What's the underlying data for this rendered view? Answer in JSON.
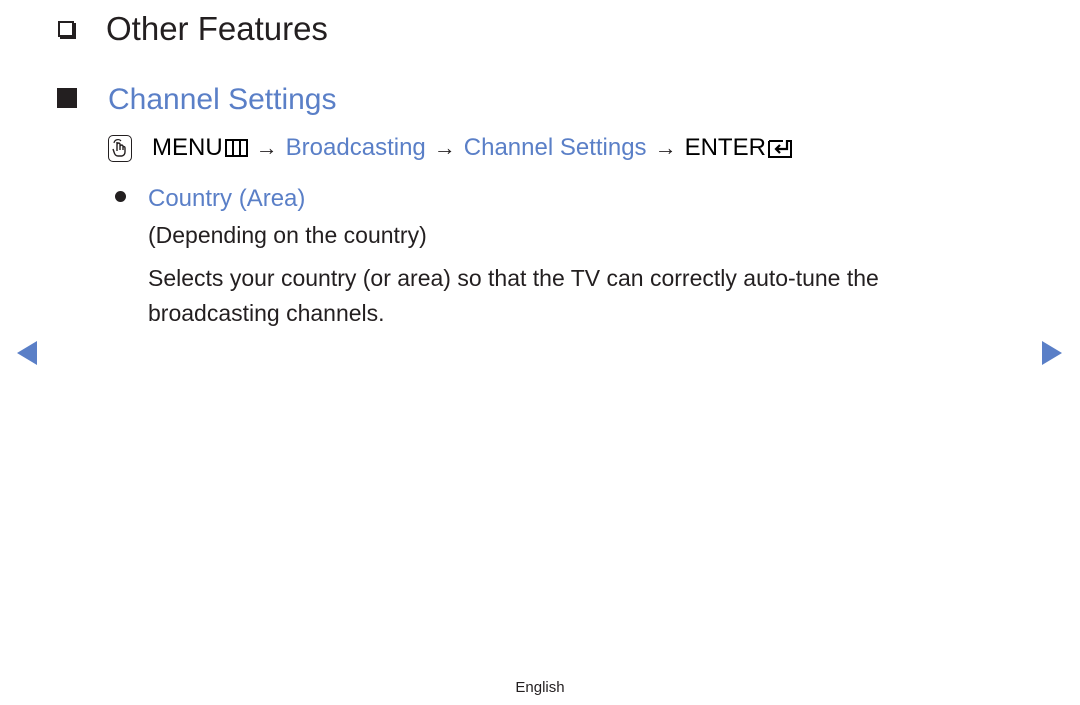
{
  "heading": {
    "icon": "checkbox-outline-icon",
    "title": "Other Features"
  },
  "section": {
    "icon": "filled-square-icon",
    "title": "Channel Settings"
  },
  "menu_path": {
    "remote_icon": "remote-touch-icon",
    "menu_label": "MENU",
    "menu_icon": "menu-grid-icon",
    "arrow": "→",
    "steps": [
      "Broadcasting",
      "Channel Settings"
    ],
    "enter_label": "ENTER",
    "enter_icon": "enter-return-icon"
  },
  "item": {
    "bullet": "bullet-dot-icon",
    "title": "Country (Area)",
    "note": "(Depending on the country)",
    "description": "Selects your country (or area) so that the TV can correctly auto-tune the broadcasting channels."
  },
  "navigation": {
    "prev_icon": "triangle-left-icon",
    "next_icon": "triangle-right-icon"
  },
  "footer": {
    "language": "English"
  },
  "colors": {
    "accent": "#5a7fc7",
    "text": "#231f20"
  }
}
